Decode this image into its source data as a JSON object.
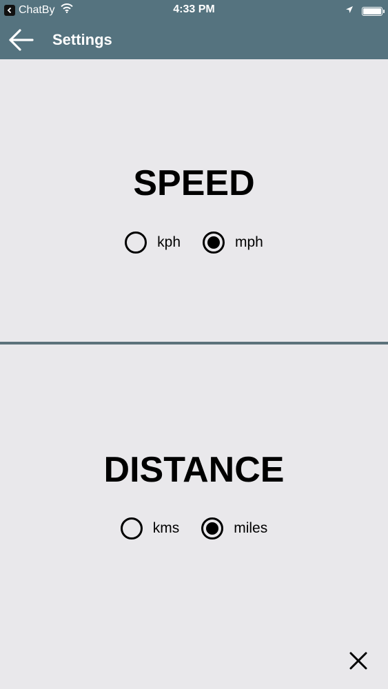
{
  "status_bar": {
    "carrier": "ChatBy",
    "time": "4:33 PM",
    "battery_level": 1.0
  },
  "app_bar": {
    "title": "Settings",
    "back_icon": "arrow-left-icon"
  },
  "speed": {
    "title": "SPEED",
    "options": [
      {
        "label": "kph",
        "selected": false
      },
      {
        "label": "mph",
        "selected": true
      }
    ]
  },
  "distance": {
    "title": "DISTANCE",
    "options": [
      {
        "label": "kms",
        "selected": false
      },
      {
        "label": "miles",
        "selected": true
      }
    ]
  },
  "footer": {
    "close_icon": "close-icon"
  },
  "colors": {
    "header_bg": "#55737f",
    "page_bg": "#e9e8eb",
    "divider": "#5c727b",
    "text": "#000000"
  }
}
